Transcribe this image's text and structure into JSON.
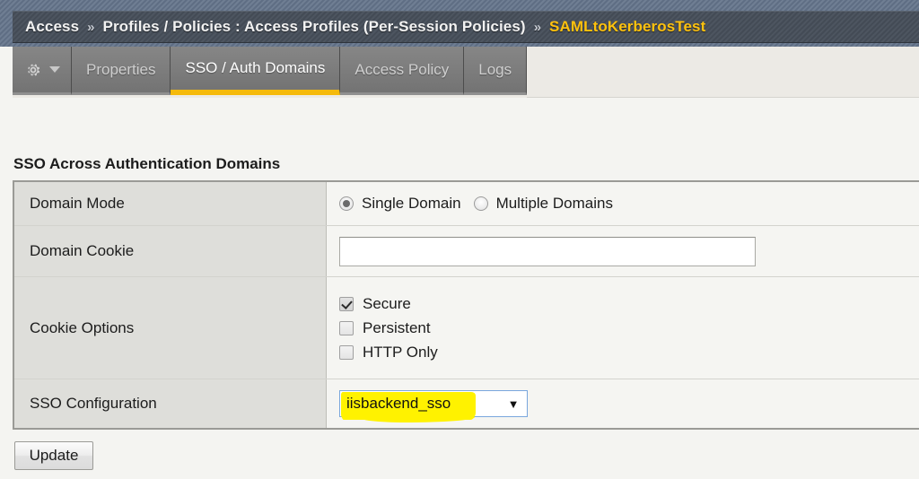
{
  "header": {
    "breadcrumb": [
      {
        "label": "Access",
        "current": false
      },
      {
        "label": "Profiles / Policies : Access Profiles (Per-Session Policies)",
        "current": false
      },
      {
        "label": "SAMLtoKerberosTest",
        "current": true
      }
    ],
    "separator": "»",
    "accent_color": "#ffc20e",
    "bar_color": "#474f5a"
  },
  "tabs": {
    "menu_icon": "gear-icon",
    "menu_caret": "▼",
    "items": [
      {
        "label": "Properties",
        "active": false
      },
      {
        "label": "SSO / Auth Domains",
        "active": true
      },
      {
        "label": "Access Policy",
        "active": false
      },
      {
        "label": "Logs",
        "active": false
      }
    ],
    "active_underline_color": "#f5ba0b"
  },
  "main": {
    "section_title": "SSO Across Authentication Domains",
    "rows": {
      "domain_mode": {
        "label": "Domain Mode",
        "options": [
          {
            "label": "Single Domain",
            "checked": true
          },
          {
            "label": "Multiple Domains",
            "checked": false
          }
        ]
      },
      "domain_cookie": {
        "label": "Domain Cookie",
        "value": "",
        "placeholder": ""
      },
      "cookie_options": {
        "label": "Cookie Options",
        "options": [
          {
            "label": "Secure",
            "checked": true
          },
          {
            "label": "Persistent",
            "checked": false
          },
          {
            "label": "HTTP Only",
            "checked": false
          }
        ]
      },
      "sso_configuration": {
        "label": "SSO Configuration",
        "selected": "iisbackend_sso",
        "arrow": "▼",
        "highlight_color": "#fff200"
      }
    },
    "update_button": "Update"
  }
}
